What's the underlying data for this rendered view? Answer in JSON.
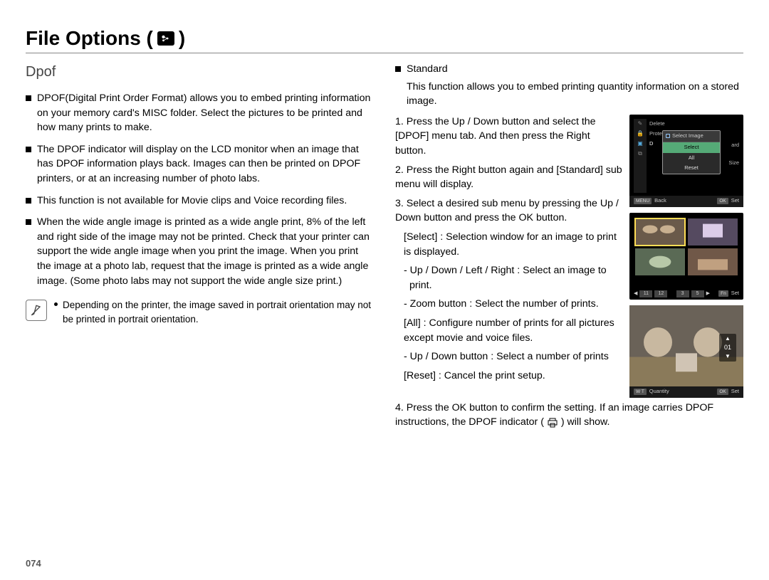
{
  "title": "File Options (",
  "title_close": ")",
  "section": "Dpof",
  "left": {
    "b1": "DPOF(Digital Print Order Format) allows you to embed printing information on your memory card's MISC folder. Select the pictures to be printed and how many prints to make.",
    "b2": "The DPOF indicator will display on the LCD monitor when an image that has DPOF information plays back. Images can then be printed on DPOF printers, or at an increasing number of photo labs.",
    "b3": "This function is not available for Movie clips and Voice recording files.",
    "b4": "When the wide angle image is printed as a wide angle print, 8% of the left and right side of the image may not be printed. Check that your printer can support the wide angle image when you print the image. When you print the image at a photo lab, request that the image is printed as a wide angle image. (Some photo labs may not support the wide angle size print.)",
    "note": "Depending on the printer, the image saved in portrait orientation may not be printed in portrait orientation."
  },
  "right": {
    "standard_title": "Standard",
    "standard_intro": "This function allows you to embed printing quantity information on a stored image.",
    "s1": "1. Press the Up / Down button and select the [DPOF] menu tab. And then press the Right button.",
    "s2": "2. Press the Right button again and [Standard] sub menu will display.",
    "s3": "3. Select a desired sub menu by pressing the Up / Down button and press the OK button.",
    "select_line": "[Select] : Selection window for an image to print is displayed.",
    "select_h1": "- Up / Down / Left / Right : Select an image to print.",
    "select_h2": "- Zoom button : Select the number of prints.",
    "all_line": "[All] : Configure number of prints for all pictures except movie and voice files.",
    "all_h1": "- Up / Down button : Select a number of prints",
    "reset_line": "[Reset] : Cancel the print setup.",
    "s4a": "4. Press the OK button to confirm the setting. If an image carries DPOF instructions, the DPOF indicator (",
    "s4b": ") will show."
  },
  "shots": {
    "menu": {
      "left_items": [
        "Delete",
        "Protect",
        "D"
      ],
      "popup_title": "Select Image",
      "options": [
        "Select",
        "All",
        "Reset"
      ],
      "right_labels": [
        "ard",
        "Size"
      ],
      "back": "Back",
      "set": "Set",
      "menu_pill": "MENU",
      "ok_pill": "OK"
    },
    "grid": {
      "left_seg": [
        "11",
        "12"
      ],
      "right_seg": [
        "3",
        "5"
      ],
      "set": "Set",
      "ok_pill": "Fn"
    },
    "single": {
      "count": "01",
      "quantity": "Quantity",
      "set": "Set",
      "w_pill": "W  T",
      "ok_pill": "OK"
    }
  },
  "page_num": "074"
}
